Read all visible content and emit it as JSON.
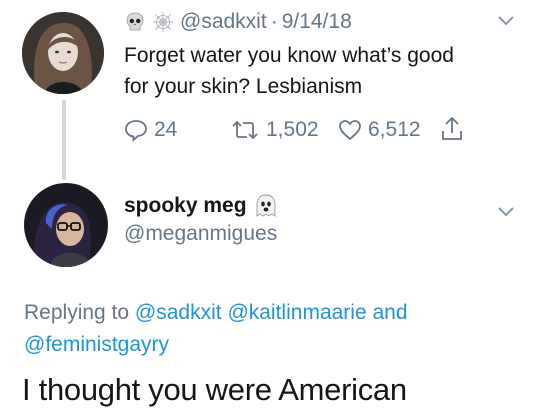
{
  "tweet1": {
    "handle": "@sadkxit",
    "separator": "·",
    "date": "9/14/18",
    "text_line1": "Forget water you know what’s good",
    "text_line2": "for your skin? Lesbianism",
    "replies": "24",
    "retweets": "1,502",
    "likes": "6,512"
  },
  "tweet2": {
    "display_name": "spooky meg",
    "handle": "@meganmigues",
    "replying_prefix": "Replying to",
    "mention1": "@sadkxit",
    "mention2": "@kaitlinmaarie",
    "and_word": "and",
    "mention3": "@feministgayry",
    "text": "I thought you were American"
  },
  "icons": [
    "skull-emoji-icon",
    "spiderweb-emoji-icon",
    "ghost-emoji-icon",
    "chevron-down-icon",
    "reply-icon",
    "retweet-icon",
    "like-icon",
    "share-icon"
  ],
  "colors": {
    "link": "#1b95e0",
    "secondary_text": "#657786",
    "thread_line": "#ccd6dd"
  }
}
